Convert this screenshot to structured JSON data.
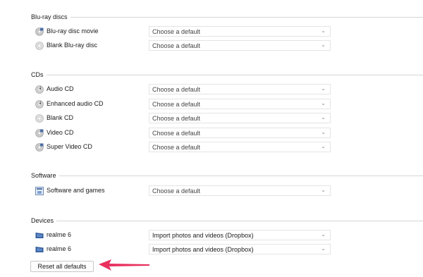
{
  "groups": [
    {
      "title": "Blu-ray discs",
      "items": [
        {
          "label": "Blu-ray disc movie",
          "value": "Choose a default",
          "icon": "bluray-disc-icon"
        },
        {
          "label": "Blank Blu-ray disc",
          "value": "Choose a default",
          "icon": "blank-disc-icon"
        }
      ]
    },
    {
      "title": "CDs",
      "items": [
        {
          "label": "Audio CD",
          "value": "Choose a default",
          "icon": "audio-cd-icon"
        },
        {
          "label": "Enhanced audio CD",
          "value": "Choose a default",
          "icon": "enhanced-audio-cd-icon"
        },
        {
          "label": "Blank CD",
          "value": "Choose a default",
          "icon": "blank-cd-icon"
        },
        {
          "label": "Video CD",
          "value": "Choose a default",
          "icon": "video-cd-icon"
        },
        {
          "label": "Super Video CD",
          "value": "Choose a default",
          "icon": "super-video-cd-icon"
        }
      ]
    },
    {
      "title": "Software",
      "items": [
        {
          "label": "Software and games",
          "value": "Choose a default",
          "icon": "software-icon"
        }
      ]
    },
    {
      "title": "Devices",
      "items": [
        {
          "label": "realme 6",
          "value": "Import photos and videos (Dropbox)",
          "icon": "phone-device-icon"
        },
        {
          "label": "realme 6",
          "value": "Import photos and videos (Dropbox)",
          "icon": "phone-device-icon"
        }
      ]
    }
  ],
  "reset_button": "Reset all defaults",
  "colors": {
    "accent_arrow": "#e8305f",
    "disc_gray": "#b8b8b8",
    "device_blue": "#2b5797"
  }
}
